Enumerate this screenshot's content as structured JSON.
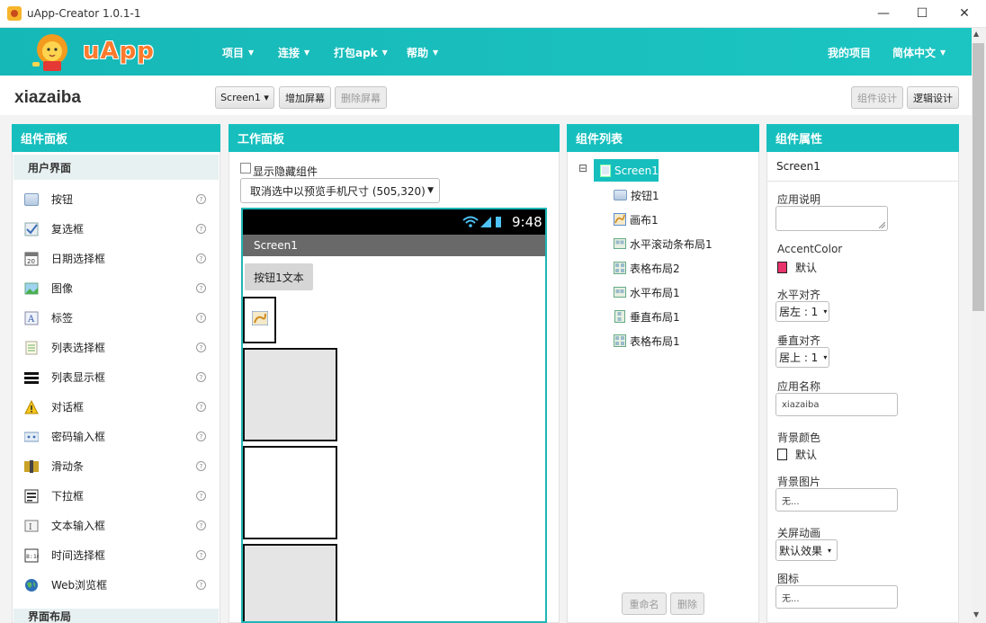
{
  "window": {
    "title": "uApp-Creator 1.0.1-1",
    "minimize": "—",
    "maximize": "☐",
    "close": "✕"
  },
  "header": {
    "logo_text": "uApp",
    "nav": [
      {
        "label": "项目",
        "caret": "▼"
      },
      {
        "label": "连接",
        "caret": "▼"
      },
      {
        "label": "打包apk",
        "caret": "▼"
      },
      {
        "label": "帮助",
        "caret": "▼"
      }
    ],
    "my_projects": "我的项目",
    "language": "简体中文",
    "language_caret": "▼"
  },
  "toolbar": {
    "project_name": "xiazaiba",
    "screen_select": "Screen1 ▾",
    "add_screen": "增加屏幕",
    "remove_screen": "删除屏幕",
    "designer": "组件设计",
    "blocks": "逻辑设计"
  },
  "palette": {
    "title": "组件面板",
    "category": "用户界面",
    "items": [
      {
        "label": "按钮",
        "icon": "button-icon"
      },
      {
        "label": "复选框",
        "icon": "checkbox-icon"
      },
      {
        "label": "日期选择框",
        "icon": "datepicker-icon"
      },
      {
        "label": "图像",
        "icon": "image-icon"
      },
      {
        "label": "标签",
        "icon": "label-icon"
      },
      {
        "label": "列表选择框",
        "icon": "listpicker-icon"
      },
      {
        "label": "列表显示框",
        "icon": "listview-icon"
      },
      {
        "label": "对话框",
        "icon": "notifier-icon"
      },
      {
        "label": "密码输入框",
        "icon": "password-icon"
      },
      {
        "label": "滑动条",
        "icon": "slider-icon"
      },
      {
        "label": "下拉框",
        "icon": "spinner-icon"
      },
      {
        "label": "文本输入框",
        "icon": "textbox-icon"
      },
      {
        "label": "时间选择框",
        "icon": "timepicker-icon"
      },
      {
        "label": "Web浏览框",
        "icon": "webviewer-icon"
      }
    ],
    "help_glyph": "?",
    "next_category": "界面布局"
  },
  "viewer": {
    "title": "工作面板",
    "show_hidden": "显示隐藏组件",
    "preview_size": "取消选中以预览手机尺寸 (505,320)",
    "preview_caret": "▼",
    "status_time": "9:48",
    "screen_title": "Screen1",
    "button_text": "按钮1文本"
  },
  "components": {
    "title": "组件列表",
    "root": "Screen1",
    "collapse_glyph": "⊟",
    "children": [
      {
        "label": "按钮1",
        "icon": "button-icon"
      },
      {
        "label": "画布1",
        "icon": "canvas-icon"
      },
      {
        "label": "水平滚动条布局1",
        "icon": "hscroll-arrangement-icon"
      },
      {
        "label": "表格布局2",
        "icon": "table-arrangement-icon"
      },
      {
        "label": "水平布局1",
        "icon": "horizontal-arrangement-icon"
      },
      {
        "label": "垂直布局1",
        "icon": "vertical-arrangement-icon"
      },
      {
        "label": "表格布局1",
        "icon": "table-arrangement-icon"
      }
    ],
    "rename": "重命名",
    "delete": "删除"
  },
  "properties": {
    "title": "组件属性",
    "component": "Screen1",
    "about_label": "应用说明",
    "accent_label": "AccentColor",
    "accent_value": "默认",
    "accent_color": "#e8336d",
    "halign_label": "水平对齐",
    "halign_value": "居左 : 1",
    "valign_label": "垂直对齐",
    "valign_value": "居上 : 1",
    "appname_label": "应用名称",
    "appname_value": "xiazaiba",
    "bgcolor_label": "背景颜色",
    "bgcolor_value": "默认",
    "bgimage_label": "背景图片",
    "bgimage_value": "无...",
    "close_anim_label": "关屏动画",
    "close_anim_value": "默认效果",
    "icon_label": "图标",
    "icon_value": "无...",
    "select_caret": "▾"
  },
  "colors": {
    "teal": "#16bfbe",
    "logo_orange": "#ff7a2d"
  }
}
